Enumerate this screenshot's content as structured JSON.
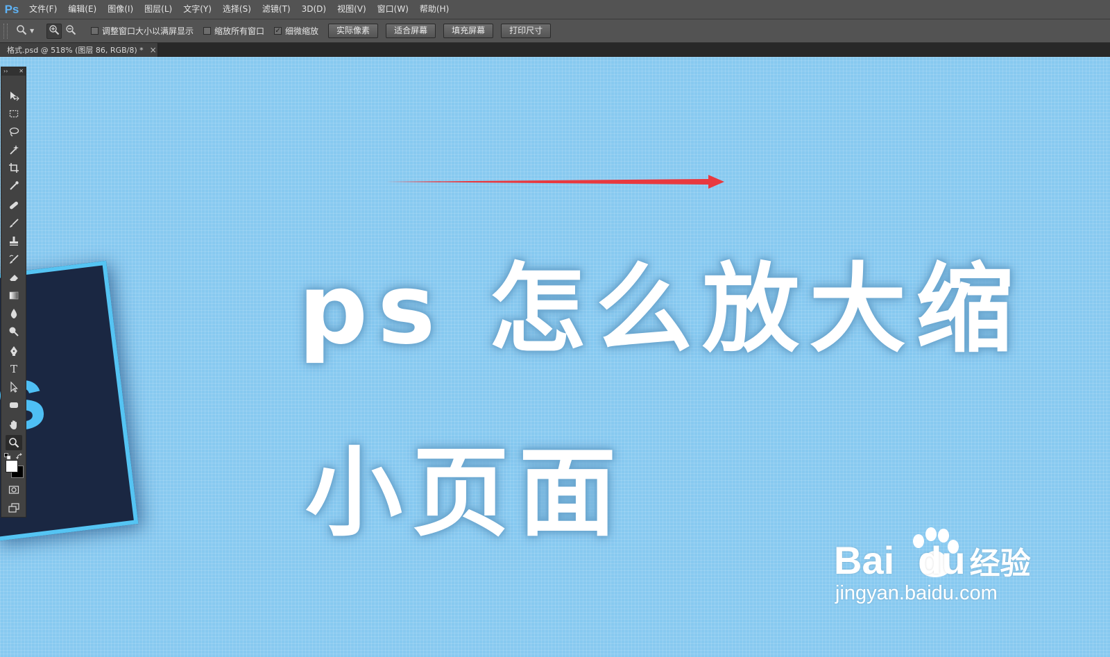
{
  "app": {
    "logo": "Ps",
    "icon": "ps-logo-icon"
  },
  "menu": {
    "items": [
      {
        "label": "文件(F)"
      },
      {
        "label": "编辑(E)"
      },
      {
        "label": "图像(I)"
      },
      {
        "label": "图层(L)"
      },
      {
        "label": "文字(Y)"
      },
      {
        "label": "选择(S)"
      },
      {
        "label": "滤镜(T)"
      },
      {
        "label": "3D(D)"
      },
      {
        "label": "视图(V)"
      },
      {
        "label": "窗口(W)"
      },
      {
        "label": "帮助(H)"
      }
    ]
  },
  "options": {
    "tool_icon": "zoom-icon",
    "checkboxes": [
      {
        "label": "调整窗口大小以满屏显示",
        "checked": false
      },
      {
        "label": "缩放所有窗口",
        "checked": false
      },
      {
        "label": "细微缩放",
        "checked": true
      }
    ],
    "buttons": [
      "实际像素",
      "适合屏幕",
      "填充屏幕",
      "打印尺寸"
    ],
    "checkmark": "✓"
  },
  "document": {
    "tab_title": "格式.psd @ 518% (图层 86, RGB/8) *",
    "close_glyph": "×"
  },
  "toolbox": {
    "head_left": "››",
    "head_right": "✕",
    "tools": [
      "move-tool",
      "marquee-tool",
      "lasso-tool",
      "magic-wand-tool",
      "crop-tool",
      "eyedropper-tool",
      "healing-brush-tool",
      "brush-tool",
      "clone-stamp-tool",
      "history-brush-tool",
      "eraser-tool",
      "gradient-tool",
      "blur-tool",
      "dodge-tool",
      "pen-tool",
      "type-tool",
      "path-selection-tool",
      "shape-tool",
      "hand-tool",
      "zoom-tool"
    ],
    "type_glyph": "T",
    "active_tool": "zoom-tool",
    "foreground_color": "#ffffff",
    "background_color": "#000000"
  },
  "canvas": {
    "background": "#88c9f0",
    "title_line1": "ps 怎么放大缩",
    "title_line2": "小页面",
    "fragment_letter": "s",
    "arrow_color": "#e8393f"
  },
  "watermark": {
    "brand": "Bai",
    "brand_tail": "du",
    "brand_cn": "经验",
    "url": "jingyan.baidu.com"
  }
}
